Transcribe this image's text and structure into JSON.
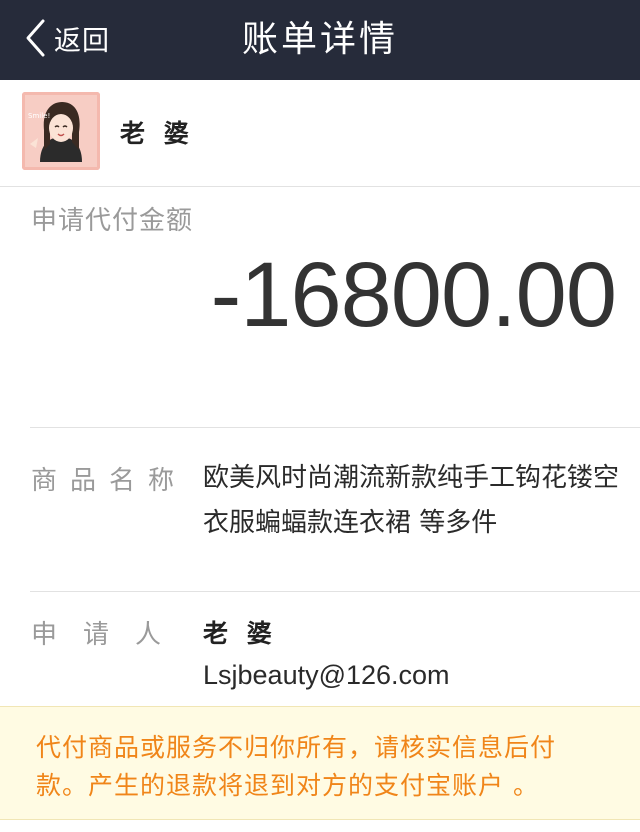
{
  "header": {
    "back_label": "返回",
    "title": "账单详情",
    "background": "#262b3a"
  },
  "profile": {
    "name": "老 婆",
    "avatar_icon": "avatar-girl-illustration"
  },
  "amount": {
    "label": "申请代付金额",
    "value": "-16800.00"
  },
  "product": {
    "label": "商品名称",
    "value": "欧美风时尚潮流新款纯手工钩花镂空衣服蝙蝠款连衣裙 等多件"
  },
  "applicant": {
    "label": "申请人",
    "name": "老 婆",
    "email": "Lsjbeauty@126.com"
  },
  "notice": {
    "text": "代付商品或服务不归你所有，请核实信息后付款。产生的退款将退到对方的支付宝账户 。",
    "color": "#f08519",
    "background": "#fffbe3"
  }
}
